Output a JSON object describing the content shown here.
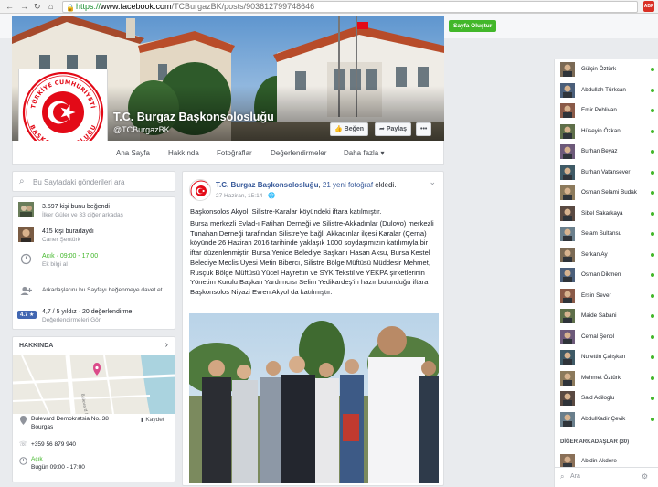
{
  "browser": {
    "url_https": "https://",
    "url_host": "www.facebook.com",
    "url_path": "/TCBurgazBK/posts/903612799748646",
    "extension_badge": "ABP"
  },
  "topbar": {
    "create_page": "Sayfa Oluştur"
  },
  "page": {
    "name": "T.C. Burgaz Başkonsolosluğu",
    "handle": "@TCBurgazBK",
    "seal_top": "TÜRKİYE CUMHURİYETİ",
    "seal_bottom": "BAŞKONSOLOSLUĞU",
    "like_button": "Beğen",
    "share_button": "Paylaş",
    "more_button": "•••"
  },
  "tabs": [
    "Ana Sayfa",
    "Hakkında",
    "Fotoğraflar",
    "Değerlendirmeler",
    "Daha fazla ▾"
  ],
  "left": {
    "search_placeholder": "Bu Sayfadaki gönderileri ara",
    "likes_main": "3.597 kişi bunu beğendi",
    "likes_sub": "İlker Güler ve 33 diğer arkadaş",
    "checkins_main": "415 kişi buradaydı",
    "checkins_sub": "Caner Şentürk",
    "open_main": "Açık · 09:00 - 17:00",
    "open_sub": "Ek bilgi al",
    "invite": "Arkadaşlarını bu Sayfayı beğenmeye davet et",
    "rating_badge": "4.7 ★",
    "rating_main": "4,7 / 5 yıldız · 20 değerlendirme",
    "rating_sub": "Değerlendirmeleri Gör",
    "about_title": "HAKKINDA",
    "address1": "Bulevard Demokratsia No. 38",
    "address2": "Bourgas",
    "save": "Kaydet",
    "phone": "+359 56 879 940",
    "hours_open": "Açık",
    "hours_today": "Bugün 09:00 - 17:00",
    "map_street": "Bulevard Demokratsia"
  },
  "post": {
    "author": "T.C. Burgaz Başkonsolosluğu",
    "action_pre": ", ",
    "photo_count": "21 yeni fotoğraf",
    "action_post": " ekledi.",
    "time": "27 Haziran, 15:14 · 🌐",
    "title": "Başkonsolos Akyol, Silistre-Karalar köyündeki iftara katılmıştır.",
    "body": "Bursa merkezli Evlad-ı Fatihan Derneği ve Silistre-Akkadınlar (Dulovo) merkezli Tunahan Derneği tarafından Silistre'ye bağlı Akkadınlar ilçesi Karalar (Çerna) köyünde 26 Haziran 2016 tarihinde yaklaşık 1000 soydaşımızın katılımıyla bir iftar düzenlenmiştir. Bursa Yenice Belediye Başkanı Hasan Aksu, Bursa Kestel Belediye Meclis Üyesi Metin Bibercı, Silistre Bölge Müftüsü Müddesir Mehmet, Rusçuk Bölge Müftüsü Yücel Hayrettin ve SYK Tekstil ve YEKPA şirketlerinin Yönetim Kurulu Başkan Yardımcısı Selim Yedikardeş'in hazır bulunduğu iftara Başkonsolos Niyazi Evren Akyol da katılmıştır."
  },
  "chat": {
    "contacts": [
      "Gülçin Öztürk",
      "Abdullah Türkcan",
      "Emir Pehlivan",
      "Hüseyin Özkan",
      "Burhan Beyaz",
      "Burhan Vatansever",
      "Osman Selami Budak",
      "Sibel Sakarkaya",
      "Selam Sultansu",
      "Serkan Ay",
      "Osman Dikmen",
      "Ersin Sever",
      "Maide Sabani",
      "Cemal Şenol",
      "Nurettin Çalışkan",
      "Mehmet Öztürk",
      "Said Adiloglu",
      "AbdulKadir Çevik"
    ],
    "other_friends": "DİĞER ARKADAŞLAR (30)",
    "other_first": "Abidin Akdere",
    "search_placeholder": "Ara"
  },
  "colors": {
    "fb_blue": "#365899",
    "green": "#42b72a",
    "flag_red": "#e30a17"
  }
}
